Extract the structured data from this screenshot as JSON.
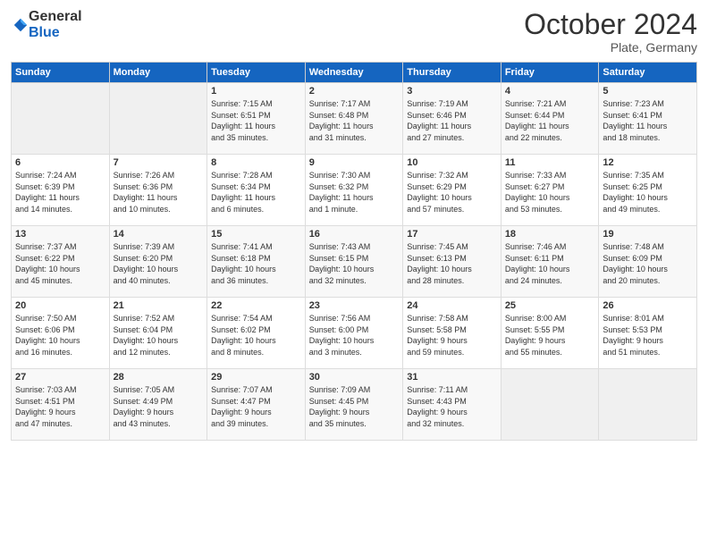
{
  "logo": {
    "general": "General",
    "blue": "Blue"
  },
  "title": "October 2024",
  "subtitle": "Plate, Germany",
  "days_header": [
    "Sunday",
    "Monday",
    "Tuesday",
    "Wednesday",
    "Thursday",
    "Friday",
    "Saturday"
  ],
  "weeks": [
    [
      {
        "day": "",
        "info": ""
      },
      {
        "day": "",
        "info": ""
      },
      {
        "day": "1",
        "info": "Sunrise: 7:15 AM\nSunset: 6:51 PM\nDaylight: 11 hours\nand 35 minutes."
      },
      {
        "day": "2",
        "info": "Sunrise: 7:17 AM\nSunset: 6:48 PM\nDaylight: 11 hours\nand 31 minutes."
      },
      {
        "day": "3",
        "info": "Sunrise: 7:19 AM\nSunset: 6:46 PM\nDaylight: 11 hours\nand 27 minutes."
      },
      {
        "day": "4",
        "info": "Sunrise: 7:21 AM\nSunset: 6:44 PM\nDaylight: 11 hours\nand 22 minutes."
      },
      {
        "day": "5",
        "info": "Sunrise: 7:23 AM\nSunset: 6:41 PM\nDaylight: 11 hours\nand 18 minutes."
      }
    ],
    [
      {
        "day": "6",
        "info": "Sunrise: 7:24 AM\nSunset: 6:39 PM\nDaylight: 11 hours\nand 14 minutes."
      },
      {
        "day": "7",
        "info": "Sunrise: 7:26 AM\nSunset: 6:36 PM\nDaylight: 11 hours\nand 10 minutes."
      },
      {
        "day": "8",
        "info": "Sunrise: 7:28 AM\nSunset: 6:34 PM\nDaylight: 11 hours\nand 6 minutes."
      },
      {
        "day": "9",
        "info": "Sunrise: 7:30 AM\nSunset: 6:32 PM\nDaylight: 11 hours\nand 1 minute."
      },
      {
        "day": "10",
        "info": "Sunrise: 7:32 AM\nSunset: 6:29 PM\nDaylight: 10 hours\nand 57 minutes."
      },
      {
        "day": "11",
        "info": "Sunrise: 7:33 AM\nSunset: 6:27 PM\nDaylight: 10 hours\nand 53 minutes."
      },
      {
        "day": "12",
        "info": "Sunrise: 7:35 AM\nSunset: 6:25 PM\nDaylight: 10 hours\nand 49 minutes."
      }
    ],
    [
      {
        "day": "13",
        "info": "Sunrise: 7:37 AM\nSunset: 6:22 PM\nDaylight: 10 hours\nand 45 minutes."
      },
      {
        "day": "14",
        "info": "Sunrise: 7:39 AM\nSunset: 6:20 PM\nDaylight: 10 hours\nand 40 minutes."
      },
      {
        "day": "15",
        "info": "Sunrise: 7:41 AM\nSunset: 6:18 PM\nDaylight: 10 hours\nand 36 minutes."
      },
      {
        "day": "16",
        "info": "Sunrise: 7:43 AM\nSunset: 6:15 PM\nDaylight: 10 hours\nand 32 minutes."
      },
      {
        "day": "17",
        "info": "Sunrise: 7:45 AM\nSunset: 6:13 PM\nDaylight: 10 hours\nand 28 minutes."
      },
      {
        "day": "18",
        "info": "Sunrise: 7:46 AM\nSunset: 6:11 PM\nDaylight: 10 hours\nand 24 minutes."
      },
      {
        "day": "19",
        "info": "Sunrise: 7:48 AM\nSunset: 6:09 PM\nDaylight: 10 hours\nand 20 minutes."
      }
    ],
    [
      {
        "day": "20",
        "info": "Sunrise: 7:50 AM\nSunset: 6:06 PM\nDaylight: 10 hours\nand 16 minutes."
      },
      {
        "day": "21",
        "info": "Sunrise: 7:52 AM\nSunset: 6:04 PM\nDaylight: 10 hours\nand 12 minutes."
      },
      {
        "day": "22",
        "info": "Sunrise: 7:54 AM\nSunset: 6:02 PM\nDaylight: 10 hours\nand 8 minutes."
      },
      {
        "day": "23",
        "info": "Sunrise: 7:56 AM\nSunset: 6:00 PM\nDaylight: 10 hours\nand 3 minutes."
      },
      {
        "day": "24",
        "info": "Sunrise: 7:58 AM\nSunset: 5:58 PM\nDaylight: 9 hours\nand 59 minutes."
      },
      {
        "day": "25",
        "info": "Sunrise: 8:00 AM\nSunset: 5:55 PM\nDaylight: 9 hours\nand 55 minutes."
      },
      {
        "day": "26",
        "info": "Sunrise: 8:01 AM\nSunset: 5:53 PM\nDaylight: 9 hours\nand 51 minutes."
      }
    ],
    [
      {
        "day": "27",
        "info": "Sunrise: 7:03 AM\nSunset: 4:51 PM\nDaylight: 9 hours\nand 47 minutes."
      },
      {
        "day": "28",
        "info": "Sunrise: 7:05 AM\nSunset: 4:49 PM\nDaylight: 9 hours\nand 43 minutes."
      },
      {
        "day": "29",
        "info": "Sunrise: 7:07 AM\nSunset: 4:47 PM\nDaylight: 9 hours\nand 39 minutes."
      },
      {
        "day": "30",
        "info": "Sunrise: 7:09 AM\nSunset: 4:45 PM\nDaylight: 9 hours\nand 35 minutes."
      },
      {
        "day": "31",
        "info": "Sunrise: 7:11 AM\nSunset: 4:43 PM\nDaylight: 9 hours\nand 32 minutes."
      },
      {
        "day": "",
        "info": ""
      },
      {
        "day": "",
        "info": ""
      }
    ]
  ]
}
